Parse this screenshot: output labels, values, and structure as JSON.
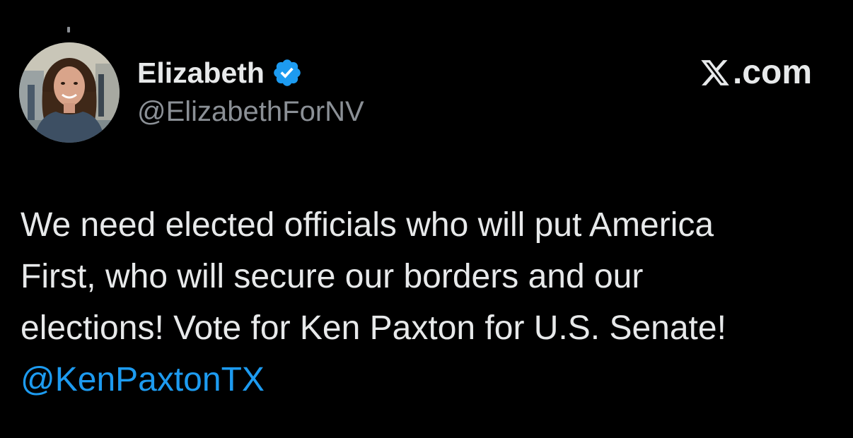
{
  "author": {
    "display_name": "Elizabeth",
    "handle": "@ElizabethForNV",
    "verified": true,
    "verified_icon": "verified-badge-icon",
    "avatar": "profile-photo"
  },
  "brand": {
    "logo_icon": "x-logo-icon",
    "domain": ".com"
  },
  "tweet": {
    "line1": "We need elected officials who will put America",
    "line2": "First, who will secure our borders and our",
    "line3": "elections! Vote for Ken Paxton for U.S. Senate!",
    "mention": "@KenPaxtonTX"
  },
  "colors": {
    "background": "#000000",
    "text": "#e7e9ea",
    "secondary_text": "#8b9096",
    "link": "#1d9bf0",
    "verified_badge": "#1d9bf0"
  }
}
